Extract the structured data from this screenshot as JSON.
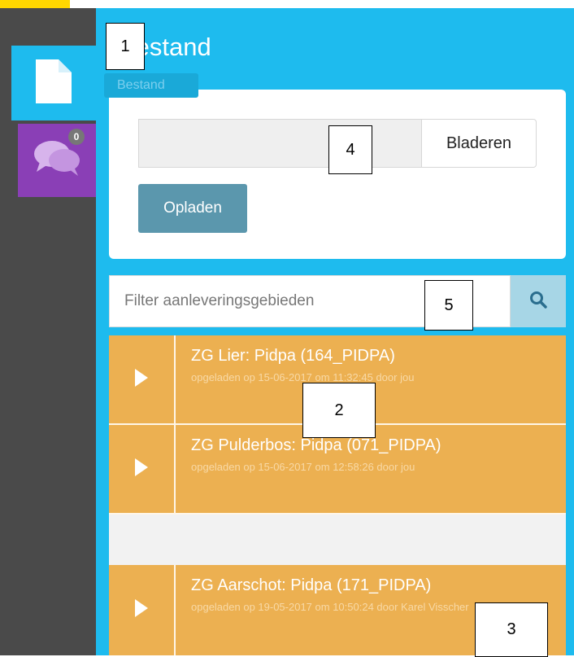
{
  "sidebar": {
    "tabs": [
      {
        "name": "Bestand",
        "icon": "file-icon",
        "color": "#1ebbee"
      },
      {
        "name": "Chat",
        "icon": "chat-icon",
        "color": "#8a3fb6",
        "badge": "0"
      }
    ]
  },
  "panel": {
    "title": "Bestand",
    "tooltip": "Bestand"
  },
  "upload": {
    "file_placeholder": "",
    "browse_label": "Bladeren",
    "upload_label": "Opladen"
  },
  "filter": {
    "placeholder": "Filter aanleveringsgebieden",
    "search_icon": "search-icon"
  },
  "items": [
    {
      "title": "ZG Lier: Pidpa (164_PIDPA)",
      "meta": "opgeladen op 15-06-2017 om 11:32:45 door jou"
    },
    {
      "title": "ZG Pulderbos: Pidpa (071_PIDPA)",
      "meta": "opgeladen op 15-06-2017 om 12:58:26 door jou"
    },
    {
      "title": "ZG Aarschot: Pidpa (171_PIDPA)",
      "meta": "opgeladen op 19-05-2017 om 10:50:24 door Karel Visscher"
    }
  ],
  "annotations": [
    "1",
    "2",
    "3",
    "4",
    "5"
  ],
  "colors": {
    "accent": "#1ebbee",
    "item": "#ecb051",
    "chat": "#8a3fb6",
    "button": "#5b97ad"
  }
}
